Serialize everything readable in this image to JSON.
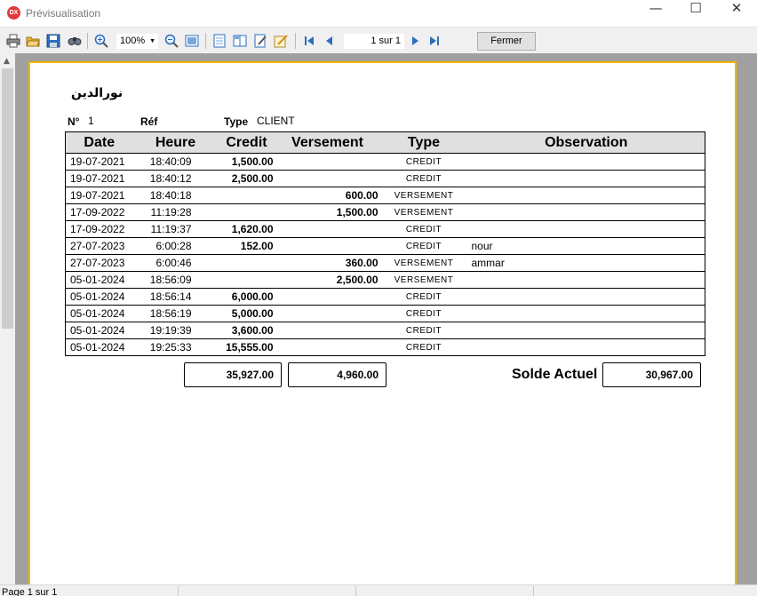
{
  "window": {
    "title": "Prévisualisation",
    "app_icon_text": "DX",
    "minimize_glyph": "—",
    "maximize_glyph": "☐",
    "close_glyph": "✕"
  },
  "toolbar": {
    "icons": [
      "print-icon",
      "open-folder-icon",
      "save-icon",
      "find-icon",
      "zoom-in-icon",
      "zoom-out-icon",
      "full-page-icon",
      "single-page-icon",
      "two-pages-icon",
      "edit-icon",
      "notes-icon",
      "first-page-icon",
      "prev-page-icon",
      "next-page-icon",
      "last-page-icon"
    ],
    "zoom": "100%",
    "page_indicator": "1 sur 1",
    "close_label": "Fermer"
  },
  "report": {
    "client_name": "نورالدين",
    "no_label": "N°",
    "no_value": "1",
    "ref_label": "Réf",
    "type_label": "Type",
    "type_value": "CLIENT",
    "columns": [
      "Date",
      "Heure",
      "Credit",
      "Versement",
      "Type",
      "Observation"
    ],
    "rows": [
      [
        "19-07-2021",
        "18:40:09",
        "1,500.00",
        "",
        "CREDIT",
        ""
      ],
      [
        "19-07-2021",
        "18:40:12",
        "2,500.00",
        "",
        "CREDIT",
        ""
      ],
      [
        "19-07-2021",
        "18:40:18",
        "",
        "600.00",
        "VERSEMENT",
        ""
      ],
      [
        "17-09-2022",
        "11:19:28",
        "",
        "1,500.00",
        "VERSEMENT",
        ""
      ],
      [
        "17-09-2022",
        "11:19:37",
        "1,620.00",
        "",
        "CREDIT",
        ""
      ],
      [
        "27-07-2023",
        "6:00:28",
        "152.00",
        "",
        "CREDIT",
        "nour"
      ],
      [
        "27-07-2023",
        "6:00:46",
        "",
        "360.00",
        "VERSEMENT",
        "ammar"
      ],
      [
        "05-01-2024",
        "18:56:09",
        "",
        "2,500.00",
        "VERSEMENT",
        ""
      ],
      [
        "05-01-2024",
        "18:56:14",
        "6,000.00",
        "",
        "CREDIT",
        ""
      ],
      [
        "05-01-2024",
        "18:56:19",
        "5,000.00",
        "",
        "CREDIT",
        ""
      ],
      [
        "05-01-2024",
        "19:19:39",
        "3,600.00",
        "",
        "CREDIT",
        ""
      ],
      [
        "05-01-2024",
        "19:25:33",
        "15,555.00",
        "",
        "CREDIT",
        ""
      ]
    ],
    "total_credit": "35,927.00",
    "total_versement": "4,960.00",
    "solde_label": "Solde Actuel",
    "solde_value": "30,967.00"
  },
  "status": {
    "text": "Page 1 sur 1"
  },
  "colors": {
    "page_border": "#f2b600",
    "preview_bg": "#a0a0a0",
    "header_bg": "#e0e0e0",
    "toolbar_icon_blue": "#2a6ebd"
  }
}
